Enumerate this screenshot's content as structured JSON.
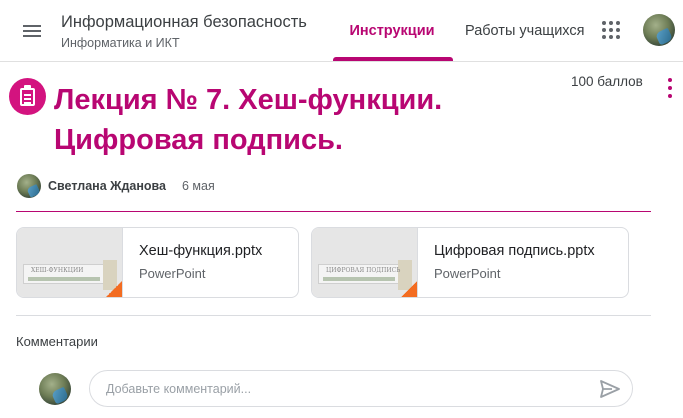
{
  "header": {
    "class_title": "Информационная безопасность",
    "class_subtitle": "Информатика и ИКТ",
    "tabs": [
      {
        "label": "Инструкции",
        "active": true
      },
      {
        "label": "Работы учащихся",
        "active": false
      }
    ],
    "icons": {
      "menu": "hamburger-menu-icon",
      "apps": "apps-grid-icon",
      "avatar": "user-avatar"
    }
  },
  "assignment": {
    "icon": "assignment-icon",
    "title": "Лекция № 7. Хеш-функции. Цифровая подпись.",
    "points": "100 баллов",
    "author": "Светлана Жданова",
    "date": "6 мая"
  },
  "attachments": [
    {
      "name": "Хеш-функция.pptx",
      "type": "PowerPoint",
      "thumb_text": "ХЕШ-ФУНКЦИИ"
    },
    {
      "name": "Цифровая подпись.pptx",
      "type": "PowerPoint",
      "thumb_text": "ЦИФРОВАЯ ПОДПИСЬ"
    }
  ],
  "comments": {
    "label": "Комментарии",
    "placeholder": "Добавьте комментарий..."
  },
  "colors": {
    "accent": "#b80672",
    "accent_bright": "#d3137f",
    "powerpoint": "#f36c21"
  }
}
